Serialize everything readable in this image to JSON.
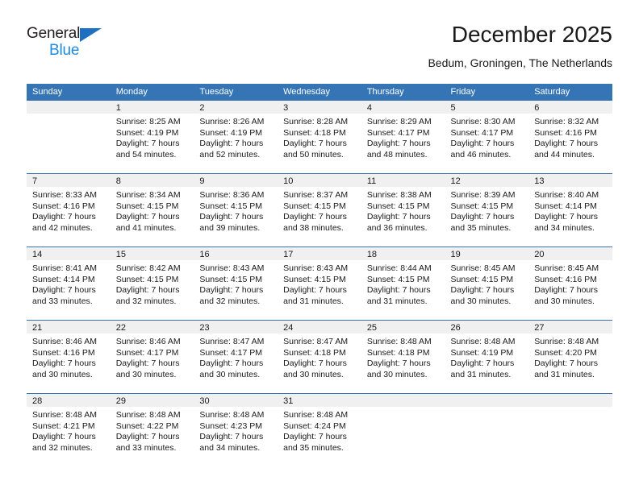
{
  "brand": {
    "line1": "General",
    "line2": "Blue",
    "triangle_icon": "triangle-icon",
    "color_dark": "#231f20",
    "color_blue": "#1f8ae0",
    "color_triangle": "#1f70c1"
  },
  "header": {
    "title": "December 2025",
    "subtitle": "Bedum, Groningen, The Netherlands"
  },
  "theme": {
    "accent": "#3575b5",
    "daynum_band": "#f0f0f0",
    "text": "#1a1a1a"
  },
  "calendar": {
    "weekday_headers": [
      "Sunday",
      "Monday",
      "Tuesday",
      "Wednesday",
      "Thursday",
      "Friday",
      "Saturday"
    ],
    "weeks": [
      [
        {
          "day": "",
          "lines": []
        },
        {
          "day": "1",
          "lines": [
            "Sunrise: 8:25 AM",
            "Sunset: 4:19 PM",
            "Daylight: 7 hours",
            "and 54 minutes."
          ]
        },
        {
          "day": "2",
          "lines": [
            "Sunrise: 8:26 AM",
            "Sunset: 4:19 PM",
            "Daylight: 7 hours",
            "and 52 minutes."
          ]
        },
        {
          "day": "3",
          "lines": [
            "Sunrise: 8:28 AM",
            "Sunset: 4:18 PM",
            "Daylight: 7 hours",
            "and 50 minutes."
          ]
        },
        {
          "day": "4",
          "lines": [
            "Sunrise: 8:29 AM",
            "Sunset: 4:17 PM",
            "Daylight: 7 hours",
            "and 48 minutes."
          ]
        },
        {
          "day": "5",
          "lines": [
            "Sunrise: 8:30 AM",
            "Sunset: 4:17 PM",
            "Daylight: 7 hours",
            "and 46 minutes."
          ]
        },
        {
          "day": "6",
          "lines": [
            "Sunrise: 8:32 AM",
            "Sunset: 4:16 PM",
            "Daylight: 7 hours",
            "and 44 minutes."
          ]
        }
      ],
      [
        {
          "day": "7",
          "lines": [
            "Sunrise: 8:33 AM",
            "Sunset: 4:16 PM",
            "Daylight: 7 hours",
            "and 42 minutes."
          ]
        },
        {
          "day": "8",
          "lines": [
            "Sunrise: 8:34 AM",
            "Sunset: 4:15 PM",
            "Daylight: 7 hours",
            "and 41 minutes."
          ]
        },
        {
          "day": "9",
          "lines": [
            "Sunrise: 8:36 AM",
            "Sunset: 4:15 PM",
            "Daylight: 7 hours",
            "and 39 minutes."
          ]
        },
        {
          "day": "10",
          "lines": [
            "Sunrise: 8:37 AM",
            "Sunset: 4:15 PM",
            "Daylight: 7 hours",
            "and 38 minutes."
          ]
        },
        {
          "day": "11",
          "lines": [
            "Sunrise: 8:38 AM",
            "Sunset: 4:15 PM",
            "Daylight: 7 hours",
            "and 36 minutes."
          ]
        },
        {
          "day": "12",
          "lines": [
            "Sunrise: 8:39 AM",
            "Sunset: 4:15 PM",
            "Daylight: 7 hours",
            "and 35 minutes."
          ]
        },
        {
          "day": "13",
          "lines": [
            "Sunrise: 8:40 AM",
            "Sunset: 4:14 PM",
            "Daylight: 7 hours",
            "and 34 minutes."
          ]
        }
      ],
      [
        {
          "day": "14",
          "lines": [
            "Sunrise: 8:41 AM",
            "Sunset: 4:14 PM",
            "Daylight: 7 hours",
            "and 33 minutes."
          ]
        },
        {
          "day": "15",
          "lines": [
            "Sunrise: 8:42 AM",
            "Sunset: 4:15 PM",
            "Daylight: 7 hours",
            "and 32 minutes."
          ]
        },
        {
          "day": "16",
          "lines": [
            "Sunrise: 8:43 AM",
            "Sunset: 4:15 PM",
            "Daylight: 7 hours",
            "and 32 minutes."
          ]
        },
        {
          "day": "17",
          "lines": [
            "Sunrise: 8:43 AM",
            "Sunset: 4:15 PM",
            "Daylight: 7 hours",
            "and 31 minutes."
          ]
        },
        {
          "day": "18",
          "lines": [
            "Sunrise: 8:44 AM",
            "Sunset: 4:15 PM",
            "Daylight: 7 hours",
            "and 31 minutes."
          ]
        },
        {
          "day": "19",
          "lines": [
            "Sunrise: 8:45 AM",
            "Sunset: 4:15 PM",
            "Daylight: 7 hours",
            "and 30 minutes."
          ]
        },
        {
          "day": "20",
          "lines": [
            "Sunrise: 8:45 AM",
            "Sunset: 4:16 PM",
            "Daylight: 7 hours",
            "and 30 minutes."
          ]
        }
      ],
      [
        {
          "day": "21",
          "lines": [
            "Sunrise: 8:46 AM",
            "Sunset: 4:16 PM",
            "Daylight: 7 hours",
            "and 30 minutes."
          ]
        },
        {
          "day": "22",
          "lines": [
            "Sunrise: 8:46 AM",
            "Sunset: 4:17 PM",
            "Daylight: 7 hours",
            "and 30 minutes."
          ]
        },
        {
          "day": "23",
          "lines": [
            "Sunrise: 8:47 AM",
            "Sunset: 4:17 PM",
            "Daylight: 7 hours",
            "and 30 minutes."
          ]
        },
        {
          "day": "24",
          "lines": [
            "Sunrise: 8:47 AM",
            "Sunset: 4:18 PM",
            "Daylight: 7 hours",
            "and 30 minutes."
          ]
        },
        {
          "day": "25",
          "lines": [
            "Sunrise: 8:48 AM",
            "Sunset: 4:18 PM",
            "Daylight: 7 hours",
            "and 30 minutes."
          ]
        },
        {
          "day": "26",
          "lines": [
            "Sunrise: 8:48 AM",
            "Sunset: 4:19 PM",
            "Daylight: 7 hours",
            "and 31 minutes."
          ]
        },
        {
          "day": "27",
          "lines": [
            "Sunrise: 8:48 AM",
            "Sunset: 4:20 PM",
            "Daylight: 7 hours",
            "and 31 minutes."
          ]
        }
      ],
      [
        {
          "day": "28",
          "lines": [
            "Sunrise: 8:48 AM",
            "Sunset: 4:21 PM",
            "Daylight: 7 hours",
            "and 32 minutes."
          ]
        },
        {
          "day": "29",
          "lines": [
            "Sunrise: 8:48 AM",
            "Sunset: 4:22 PM",
            "Daylight: 7 hours",
            "and 33 minutes."
          ]
        },
        {
          "day": "30",
          "lines": [
            "Sunrise: 8:48 AM",
            "Sunset: 4:23 PM",
            "Daylight: 7 hours",
            "and 34 minutes."
          ]
        },
        {
          "day": "31",
          "lines": [
            "Sunrise: 8:48 AM",
            "Sunset: 4:24 PM",
            "Daylight: 7 hours",
            "and 35 minutes."
          ]
        },
        {
          "day": "",
          "lines": []
        },
        {
          "day": "",
          "lines": []
        },
        {
          "day": "",
          "lines": []
        }
      ]
    ]
  }
}
